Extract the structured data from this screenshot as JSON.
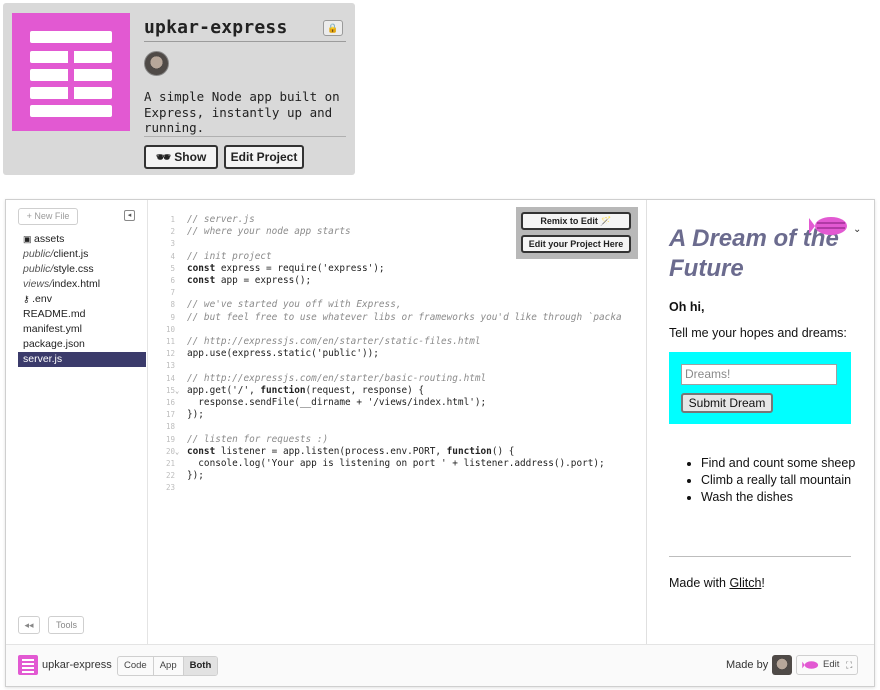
{
  "project": {
    "name": "upkar-express",
    "description": "A simple Node app built on Express, instantly up and running.",
    "lock_icon": "lock-icon",
    "show_label": "Show",
    "edit_label": "Edit Project",
    "accent": "#e259d2"
  },
  "sidebar": {
    "new_file": "+ New File",
    "files": [
      {
        "dir": "",
        "name": "assets",
        "icon": "folder-icon"
      },
      {
        "dir": "public/",
        "name": "client.js"
      },
      {
        "dir": "public/",
        "name": "style.css"
      },
      {
        "dir": "views/",
        "name": "index.html"
      },
      {
        "dir": "",
        "name": ".env",
        "icon": "key-icon"
      },
      {
        "dir": "",
        "name": "README.md"
      },
      {
        "dir": "",
        "name": "manifest.yml"
      },
      {
        "dir": "",
        "name": "package.json"
      },
      {
        "dir": "",
        "name": "server.js",
        "selected": true
      }
    ],
    "rewind_label": "◂◂",
    "tools_label": "Tools"
  },
  "editor": {
    "remix_label": "Remix to Edit",
    "edit_here_label": "Edit your Project Here",
    "lines": [
      {
        "n": "1",
        "segs": [
          {
            "t": "// server.js",
            "c": "cm"
          }
        ]
      },
      {
        "n": "2",
        "segs": [
          {
            "t": "// where your node app starts",
            "c": "cm"
          }
        ]
      },
      {
        "n": "3",
        "segs": []
      },
      {
        "n": "4",
        "segs": [
          {
            "t": "// init project",
            "c": "cm"
          }
        ]
      },
      {
        "n": "5",
        "segs": [
          {
            "t": "const",
            "c": "kw"
          },
          {
            "t": " express = require('express');",
            "c": ""
          }
        ]
      },
      {
        "n": "6",
        "segs": [
          {
            "t": "const",
            "c": "kw"
          },
          {
            "t": " app = express();",
            "c": ""
          }
        ]
      },
      {
        "n": "7",
        "segs": []
      },
      {
        "n": "8",
        "segs": [
          {
            "t": "// we've started you off with Express,",
            "c": "cm"
          }
        ]
      },
      {
        "n": "9",
        "segs": [
          {
            "t": "// but feel free to use whatever libs or frameworks you'd like through `packa",
            "c": "cm"
          }
        ]
      },
      {
        "n": "10",
        "segs": []
      },
      {
        "n": "11",
        "segs": [
          {
            "t": "// http://expressjs.com/en/starter/static-files.html",
            "c": "cm"
          }
        ]
      },
      {
        "n": "12",
        "segs": [
          {
            "t": "app.use(express.static('public'));",
            "c": ""
          }
        ]
      },
      {
        "n": "13",
        "segs": []
      },
      {
        "n": "14",
        "segs": [
          {
            "t": "// http://expressjs.com/en/starter/basic-routing.html",
            "c": "cm"
          }
        ]
      },
      {
        "n": "15",
        "segs": [
          {
            "t": "app.get('/', ",
            "c": ""
          },
          {
            "t": "function",
            "c": "kw"
          },
          {
            "t": "(request, response) {",
            "c": ""
          }
        ]
      },
      {
        "n": "16",
        "segs": [
          {
            "t": "  response.sendFile(__dirname + '/views/index.html');",
            "c": ""
          }
        ]
      },
      {
        "n": "17",
        "segs": [
          {
            "t": "});",
            "c": ""
          }
        ]
      },
      {
        "n": "18",
        "segs": []
      },
      {
        "n": "19",
        "segs": [
          {
            "t": "// listen for requests :)",
            "c": "cm"
          }
        ]
      },
      {
        "n": "20",
        "segs": [
          {
            "t": "const",
            "c": "kw"
          },
          {
            "t": " listener = app.listen(process.env.PORT, ",
            "c": ""
          },
          {
            "t": "function",
            "c": "kw"
          },
          {
            "t": "() {",
            "c": ""
          }
        ]
      },
      {
        "n": "21",
        "segs": [
          {
            "t": "  console.log('Your app is listening on port ' + listener.address().port);",
            "c": ""
          }
        ]
      },
      {
        "n": "22",
        "segs": [
          {
            "t": "});",
            "c": ""
          }
        ]
      },
      {
        "n": "23",
        "segs": []
      }
    ]
  },
  "preview": {
    "title": "A Dream of the Future",
    "greeting": "Oh hi,",
    "prompt": "Tell me your hopes and dreams:",
    "input_placeholder": "Dreams!",
    "submit_label": "Submit Dream",
    "dreams": [
      "Find and count some sheep",
      "Climb a really tall mountain",
      "Wash the dishes"
    ],
    "made_with": "Made with ",
    "glitch_link": "Glitch",
    "made_with_end": "!",
    "form_color": "#00ffff"
  },
  "footer": {
    "name": "upkar-express",
    "views": [
      "Code",
      "App",
      "Both"
    ],
    "made_by": "Made by",
    "edit_label": "Edit"
  }
}
